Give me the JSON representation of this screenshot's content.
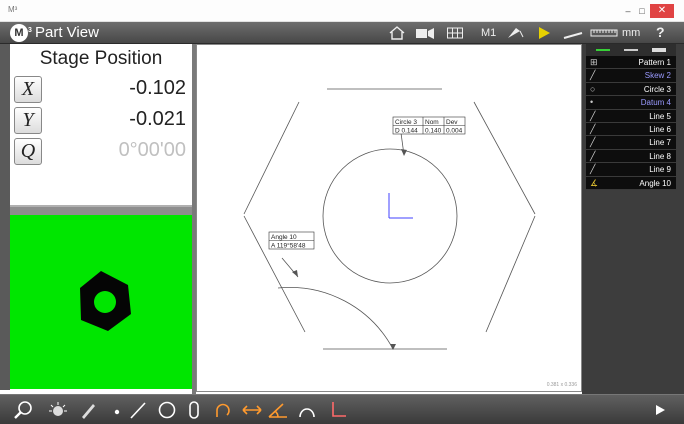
{
  "window": {
    "app_icon": "m3-small-icon",
    "min_glyph": "–",
    "max_glyph": "□",
    "close_glyph": "✕"
  },
  "titlebar": {
    "logo_letter": "M",
    "logo_sup": "3",
    "title": "Part View",
    "machine_label": "M1",
    "units_label": "mm",
    "help_label": "?"
  },
  "stage": {
    "title": "Stage Position",
    "axes": [
      {
        "label": "X",
        "value": "-0.102"
      },
      {
        "label": "Y",
        "value": "-0.021"
      },
      {
        "label": "Q",
        "value": "0°00'00"
      }
    ]
  },
  "drawing": {
    "annotations": {
      "circle": {
        "headers": [
          "Circle 3",
          "Nom",
          "Dev"
        ],
        "row": [
          "D  0.144",
          "0.140",
          "0.004"
        ]
      },
      "angle": {
        "title": "Angle 10",
        "value": "A  119°58'48"
      }
    },
    "scale_text": "0.381 x 0.336"
  },
  "features": [
    {
      "label": "Pattern 1",
      "icon": "pattern-icon",
      "color": "#ffffff"
    },
    {
      "label": "Skew 2",
      "icon": "line-icon",
      "color": "#9a9aff"
    },
    {
      "label": "Circle 3",
      "icon": "circle-icon",
      "color": "#ffffff"
    },
    {
      "label": "Datum 4",
      "icon": "point-icon",
      "color": "#9a9aff"
    },
    {
      "label": "Line 5",
      "icon": "line-icon",
      "color": "#ffffff"
    },
    {
      "label": "Line 6",
      "icon": "line-icon",
      "color": "#ffffff"
    },
    {
      "label": "Line 7",
      "icon": "line-icon",
      "color": "#ffffff"
    },
    {
      "label": "Line 8",
      "icon": "line-icon",
      "color": "#ffffff"
    },
    {
      "label": "Line 9",
      "icon": "line-icon",
      "color": "#ffffff"
    },
    {
      "label": "Angle 10",
      "icon": "angle-icon",
      "color": "#ffffff"
    }
  ],
  "colors": {
    "camera_bg": "#00e600",
    "accent_blue": "#9a9aff",
    "tool_orange": "#ff9a2e",
    "close_red": "#e04343"
  }
}
